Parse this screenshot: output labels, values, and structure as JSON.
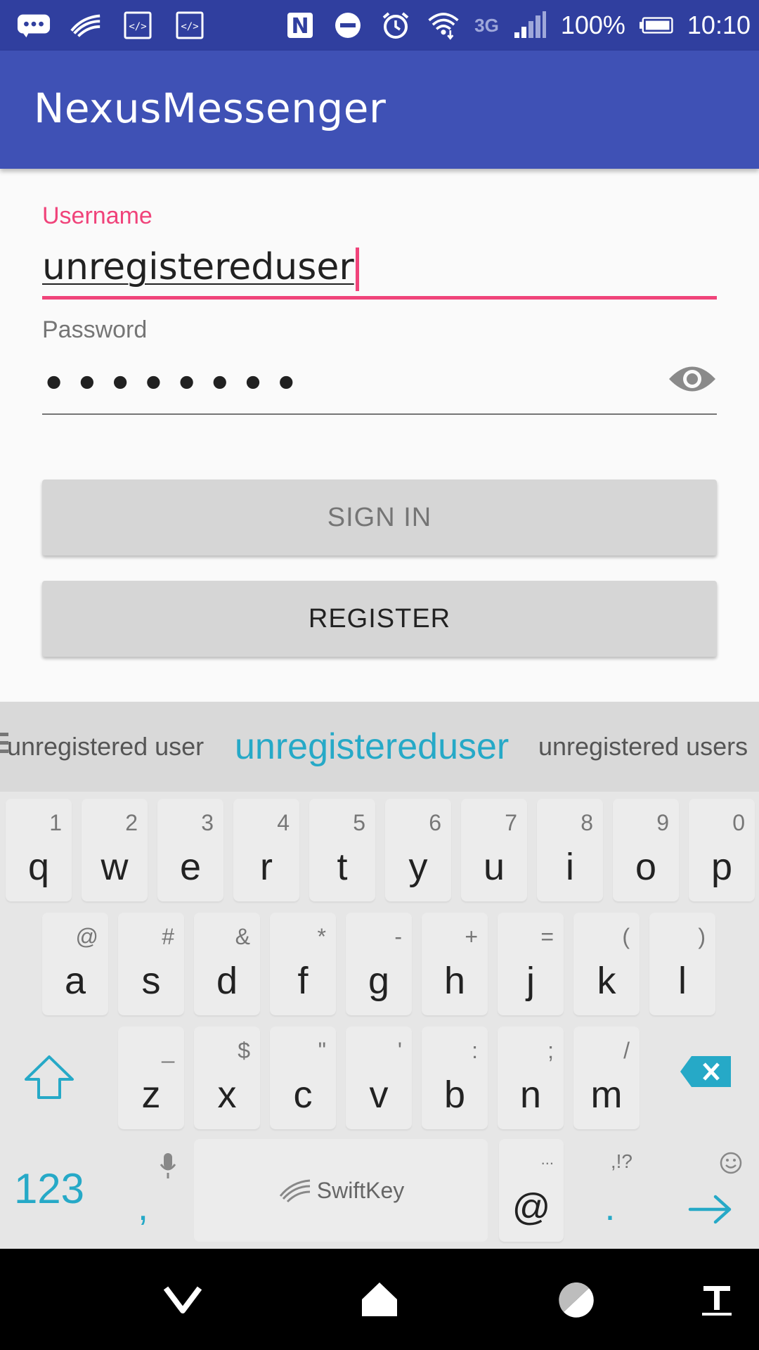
{
  "status_bar": {
    "left_icons": [
      "chat-notification-icon",
      "swiftkey-icon",
      "code-icon",
      "code-icon"
    ],
    "right_icons": [
      "nfc-icon",
      "do-not-disturb-icon",
      "alarm-icon",
      "wifi-icon",
      "cell-signal-icon",
      "battery-icon"
    ],
    "network": "3G",
    "battery": "100%",
    "time": "10:10"
  },
  "app_bar": {
    "title": "NexusMessenger"
  },
  "form": {
    "username_label": "Username",
    "username_value": "unregistereduser",
    "password_label": "Password",
    "password_value": "••••••••",
    "sign_in_label": "SIGN IN",
    "register_label": "REGISTER"
  },
  "keyboard": {
    "suggestions": [
      "unregistered user",
      "unregistereduser",
      "unregistered users"
    ],
    "row1": [
      {
        "key": "q",
        "sub": "1"
      },
      {
        "key": "w",
        "sub": "2"
      },
      {
        "key": "e",
        "sub": "3"
      },
      {
        "key": "r",
        "sub": "4"
      },
      {
        "key": "t",
        "sub": "5"
      },
      {
        "key": "y",
        "sub": "6"
      },
      {
        "key": "u",
        "sub": "7"
      },
      {
        "key": "i",
        "sub": "8"
      },
      {
        "key": "o",
        "sub": "9"
      },
      {
        "key": "p",
        "sub": "0"
      }
    ],
    "row2": [
      {
        "key": "a",
        "sub": "@"
      },
      {
        "key": "s",
        "sub": "#"
      },
      {
        "key": "d",
        "sub": "&"
      },
      {
        "key": "f",
        "sub": "*"
      },
      {
        "key": "g",
        "sub": "-"
      },
      {
        "key": "h",
        "sub": "+"
      },
      {
        "key": "j",
        "sub": "="
      },
      {
        "key": "k",
        "sub": "("
      },
      {
        "key": "l",
        "sub": ")"
      }
    ],
    "row3": [
      {
        "key": "z",
        "sub": "_"
      },
      {
        "key": "x",
        "sub": "$"
      },
      {
        "key": "c",
        "sub": "\""
      },
      {
        "key": "v",
        "sub": "'"
      },
      {
        "key": "b",
        "sub": ":"
      },
      {
        "key": "n",
        "sub": ";"
      },
      {
        "key": "m",
        "sub": "/"
      }
    ],
    "numbers_label": "123",
    "comma_label": ",",
    "space_brand": "SwiftKey",
    "at_label": "@",
    "at_sub": "...",
    "period_label": ".",
    "period_sub": ",!?",
    "accent_color": "#26a9c7"
  },
  "nav_bar": {
    "icons": [
      "back-icon",
      "home-icon",
      "recents-icon",
      "text-format-icon"
    ]
  }
}
